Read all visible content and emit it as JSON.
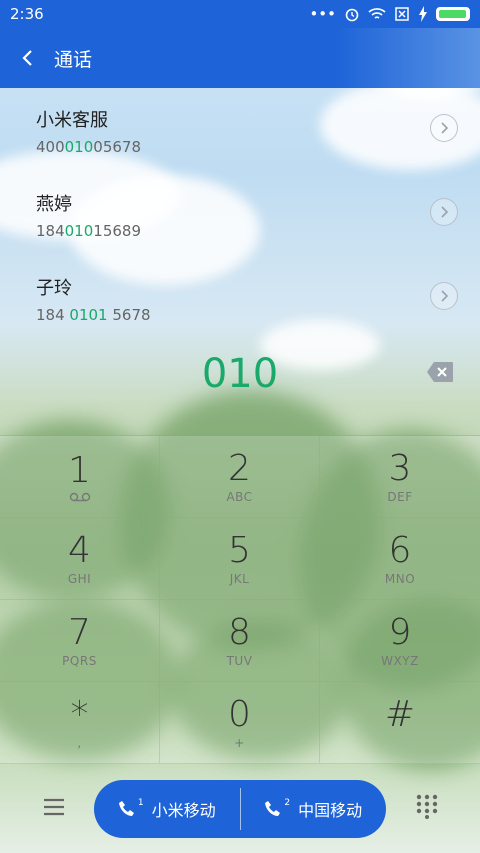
{
  "status_bar": {
    "time": "2:36"
  },
  "header": {
    "title": "通话"
  },
  "results": [
    {
      "name": "小米客服",
      "number_pre": "400",
      "number_match": "010",
      "number_post": "05678"
    },
    {
      "name": "燕婷",
      "number_pre": "184",
      "number_match": "010",
      "number_post": "15689"
    },
    {
      "name": "子玲",
      "number_pre": "184 ",
      "number_match": "0101",
      "number_post": " 5678"
    }
  ],
  "dialed": "010",
  "keypad": [
    {
      "digit": "1",
      "sub": ""
    },
    {
      "digit": "2",
      "sub": "ABC"
    },
    {
      "digit": "3",
      "sub": "DEF"
    },
    {
      "digit": "4",
      "sub": "GHI"
    },
    {
      "digit": "5",
      "sub": "JKL"
    },
    {
      "digit": "6",
      "sub": "MNO"
    },
    {
      "digit": "7",
      "sub": "PQRS"
    },
    {
      "digit": "8",
      "sub": "TUV"
    },
    {
      "digit": "9",
      "sub": "WXYZ"
    },
    {
      "digit": "*",
      "sub": ","
    },
    {
      "digit": "0",
      "sub": "+"
    },
    {
      "digit": "#",
      "sub": ""
    }
  ],
  "call_buttons": [
    {
      "label": "小米移动",
      "sim": "1"
    },
    {
      "label": "中国移动",
      "sim": "2"
    }
  ],
  "colors": {
    "accent": "#1e64d8",
    "match": "#1aa86b"
  }
}
